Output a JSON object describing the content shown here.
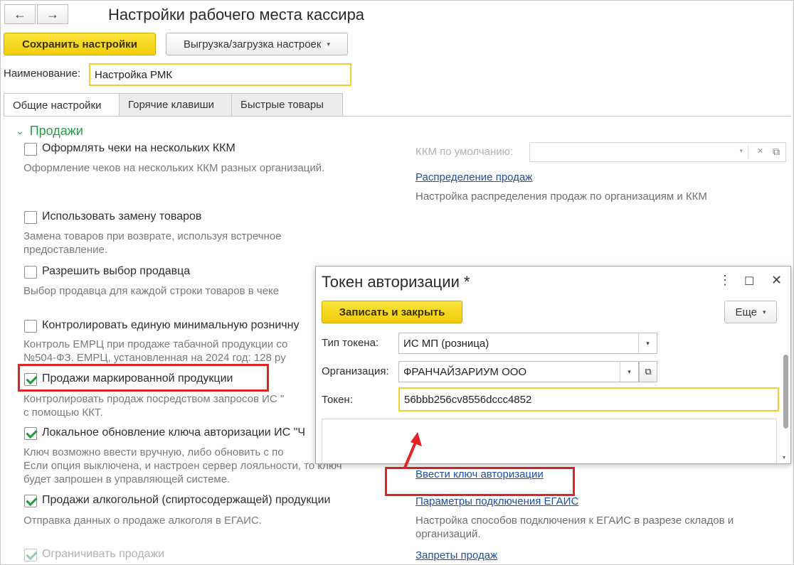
{
  "window": {
    "title": "Настройки рабочего места кассира",
    "back_icon": "←",
    "forward_icon": "→"
  },
  "toolbar": {
    "save_label": "Сохранить настройки",
    "export_label": "Выгрузка/загрузка настроек",
    "dropdown_glyph": "▾"
  },
  "name_field": {
    "label": "Наименование:",
    "value": "Настройка РМК"
  },
  "tabs": [
    {
      "label": "Общие настройки",
      "active": true
    },
    {
      "label": "Горячие клавиши",
      "active": false
    },
    {
      "label": "Быстрые товары",
      "active": false
    }
  ],
  "section": {
    "chevron": "⌄",
    "title": "Продажи"
  },
  "settings": [
    {
      "label": "Оформлять чеки на нескольких ККМ",
      "checked": false,
      "desc": "Оформление чеков на нескольких ККМ разных организаций."
    },
    {
      "label": "Использовать замену товаров",
      "checked": false,
      "desc": "Замена товаров при возврате, используя встречное предоставление."
    },
    {
      "label": "Разрешить выбор продавца",
      "checked": false,
      "desc": "Выбор продавца для каждой строки товаров в чеке"
    },
    {
      "label": "Контролировать единую минимальную розничну",
      "checked": false,
      "desc1": "Контроль ЕМРЦ при продаже табачной продукции со",
      "desc2": "№504-ФЗ. ЕМРЦ, установленная на 2024 год: 128 ру"
    },
    {
      "label": "Продажи маркированной продукции",
      "checked": true,
      "desc1": "Контролировать продаж посредством запросов ИС \"",
      "desc2": "с помощью ККТ."
    },
    {
      "label": "Локальное обновление ключа авторизации ИС \"Ч",
      "checked": true,
      "desc1": "Ключ возможно ввести вручную, либо обновить с по",
      "desc2": "Если опция выключена, и настроен сервер лояльности, то ключ",
      "desc3": "будет запрошен в управляющей системе."
    },
    {
      "label": "Продажи алкогольной (спиртосодержащей) продукции",
      "checked": true,
      "desc": "Отправка данных о продаже алкоголя в ЕГАИС."
    },
    {
      "label": "Ограничивать продажи",
      "checked": true,
      "disabled": true
    }
  ],
  "right_panel": {
    "default_kkm_label": "ККМ по умолчанию:",
    "clear_glyph": "×",
    "open_glyph": "⧉",
    "sales_distribution_link": "Распределение продаж",
    "sales_distribution_desc": "Настройка распределения продаж по организациям и ККМ",
    "enter_key_link": "Ввести ключ авторизации",
    "egais_link": "Параметры подключения ЕГАИС",
    "egais_desc": "Настройка способов подключения к ЕГАИС в разрезе складов и организаций.",
    "bans_link": "Запреты продаж"
  },
  "dialog": {
    "title": "Токен авторизации *",
    "menu_icon": "⋮",
    "maximize_icon": "☐",
    "close_icon": "✕",
    "write_close_label": "Записать и закрыть",
    "more_label": "Еще",
    "token_type_label": "Тип токена:",
    "token_type_value": "ИС МП (розница)",
    "org_label": "Организация:",
    "org_value": "ФРАНЧАЙЗАРИУМ ООО",
    "token_label": "Токен:",
    "token_value": "56bbb256cv8556dccc4852"
  },
  "colors": {
    "accent_yellow": "#f5d41a",
    "section_green": "#2c9b47",
    "link_blue": "#1f4f9d",
    "highlight_red": "#e02424"
  }
}
